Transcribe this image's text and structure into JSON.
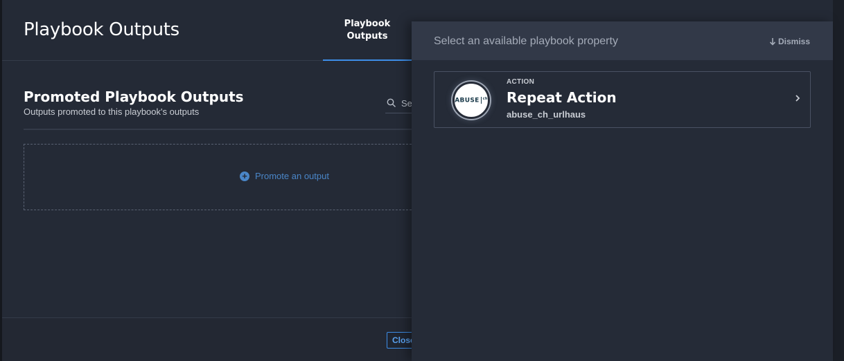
{
  "modal": {
    "title": "Playbook Outputs",
    "tab_label": "Playbook\nOutputs",
    "section_title": "Promoted Playbook Outputs",
    "section_subtitle": "Outputs promoted to this playbook's outputs",
    "search_placeholder": "Se",
    "promote_label": "Promote an output",
    "close_label": "Close"
  },
  "flyout": {
    "title": "Select an available playbook property",
    "dismiss_label": "Dismiss",
    "items": [
      {
        "kicker": "ACTION",
        "title": "Repeat Action",
        "subtitle": "abuse_ch_urlhaus",
        "logo_text": "ABUSE",
        "logo_sup": "ch",
        "icon": "abuse-ch-logo-icon"
      }
    ]
  },
  "colors": {
    "accent": "#3d8ee8",
    "link": "#4a86c8",
    "background": "#242a36"
  }
}
